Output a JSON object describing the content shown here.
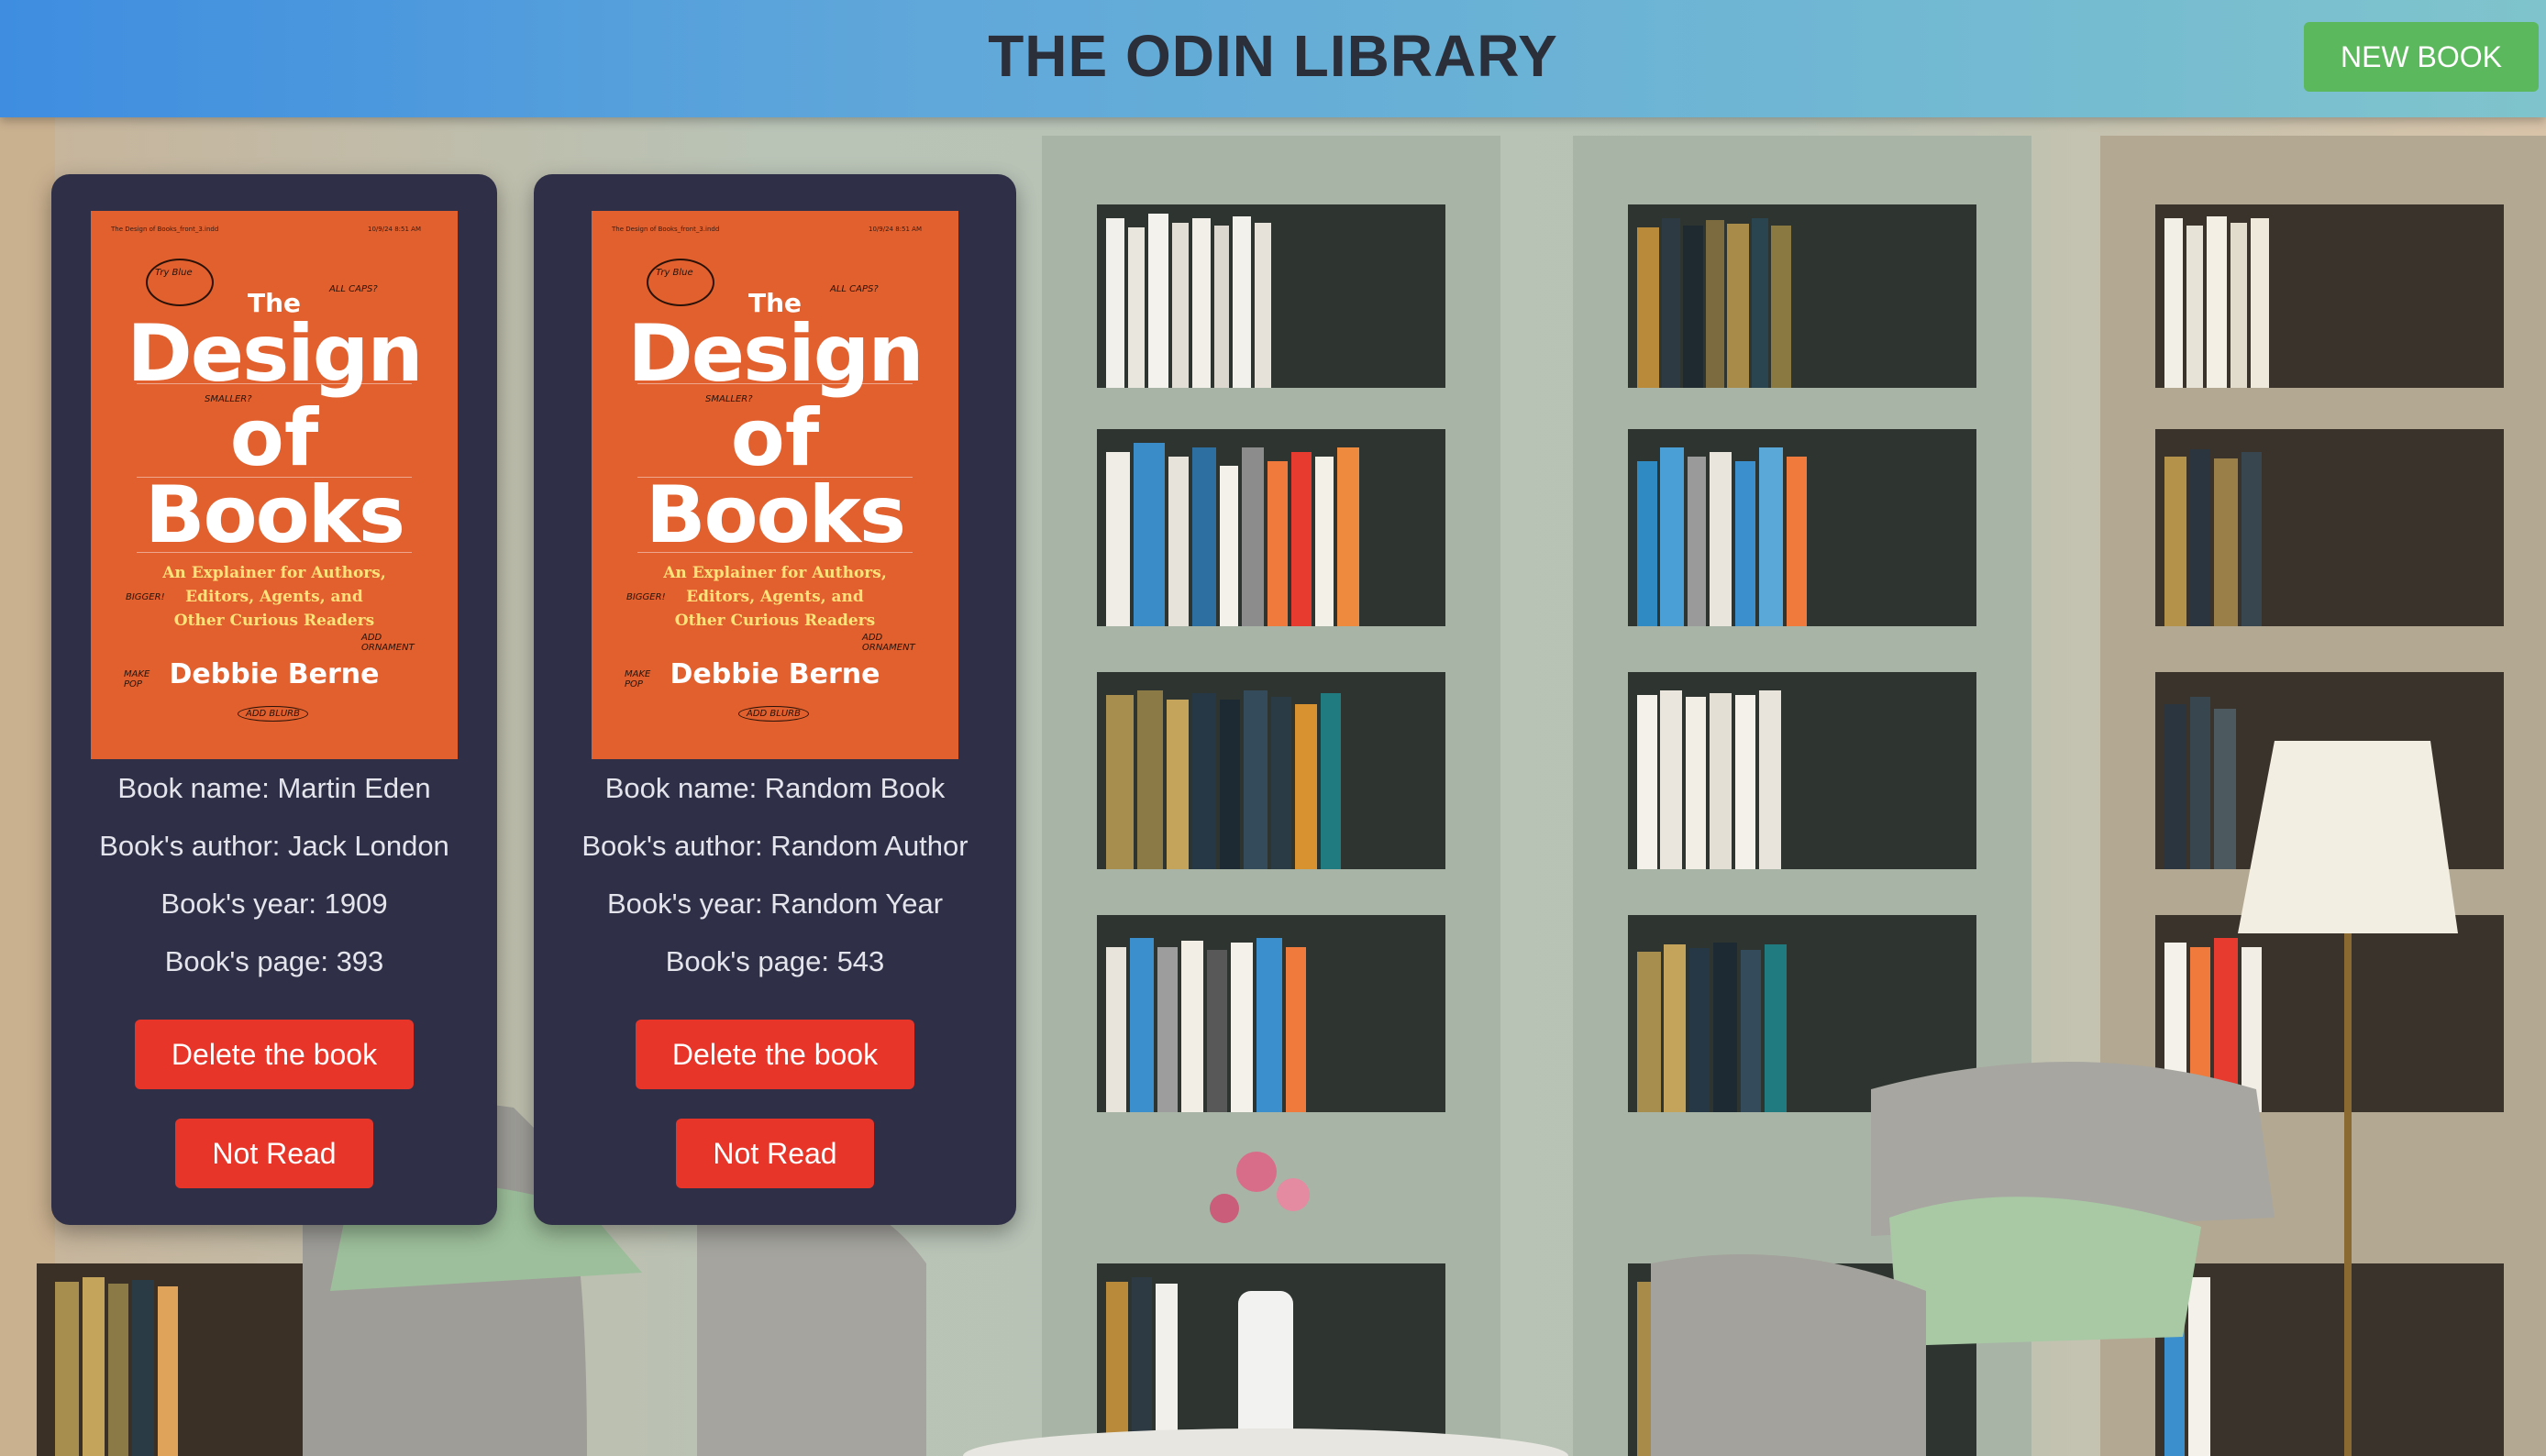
{
  "header": {
    "title": "THE ODIN LIBRARY",
    "new_book_label": "NEW BOOK"
  },
  "cover": {
    "top_left_tiny": "The Design of Books_front_3.indd",
    "top_right_tiny": "10/9/24  8:51 AM",
    "the": "The",
    "design": "Design",
    "of": "of",
    "books": "Books",
    "subtitle_line1": "An Explainer for Authors,",
    "subtitle_line2": "Editors, Agents, and",
    "subtitle_line3": "Other Curious Readers",
    "author": "Debbie Berne",
    "doodle_try_blue": "Try Blue",
    "doodle_all_caps": "ALL CAPS?",
    "doodle_smaller": "SMALLER?",
    "doodle_bigger": "BIGGER!",
    "doodle_add_ornament": "ADD ORNAMENT",
    "doodle_make_pop": "MAKE POP",
    "doodle_add_blurb": "ADD BLURB"
  },
  "books": [
    {
      "name": "Book name: Martin Eden",
      "author": "Book's author: Jack London",
      "year": "Book's year: 1909",
      "pages": "Book's page: 393",
      "delete_label": "Delete the book",
      "read_label": "Not Read"
    },
    {
      "name": "Book name: Random Book",
      "author": "Book's author: Random Author",
      "year": "Book's year: Random Year",
      "pages": "Book's page: 543",
      "delete_label": "Delete the book",
      "read_label": "Not Read"
    }
  ],
  "colors": {
    "header_start": "#3e8de0",
    "header_end": "#7fc4cc",
    "new_book_button": "#5cb85c",
    "card_bg": "#2f3047",
    "action_button": "#e8352a",
    "cover_bg": "#e1602e"
  }
}
